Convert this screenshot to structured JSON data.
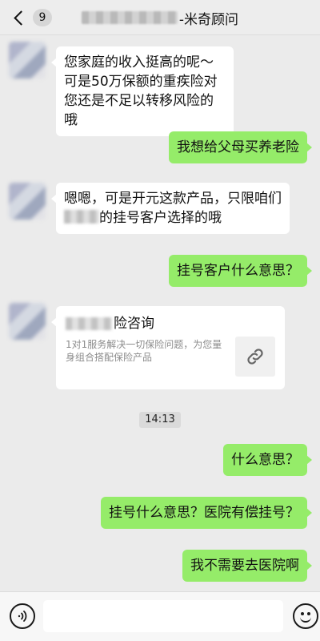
{
  "header": {
    "back_badge": "9",
    "title_suffix": "-米奇顾问"
  },
  "messages": [
    {
      "side": "left",
      "text": "您家庭的收入挺高的呢～可是50万保额的重疾险对您还是不足以转移风险的哦"
    },
    {
      "side": "right",
      "text": "我想给父母买养老险"
    },
    {
      "side": "left",
      "text_before": "嗯嗯，可是开元这款产品，只限咱们",
      "text_after": "的挂号客户选择的哦"
    },
    {
      "side": "right",
      "text": "挂号客户什么意思？"
    },
    {
      "side": "right",
      "text": "什么意思？"
    },
    {
      "side": "right",
      "text": "挂号什么意思？医院有偿挂号？"
    },
    {
      "side": "right",
      "text": "我不需要去医院啊"
    }
  ],
  "link_card": {
    "title_suffix": "险咨询",
    "description": "1对1服务解决一切保险问题，为您量身组合搭配保险产品",
    "thumb_icon": "link-icon"
  },
  "timestamp": "14:13",
  "input_bar": {
    "voice_icon": "voice-icon",
    "emoji_icon": "emoji-icon",
    "placeholder": ""
  }
}
